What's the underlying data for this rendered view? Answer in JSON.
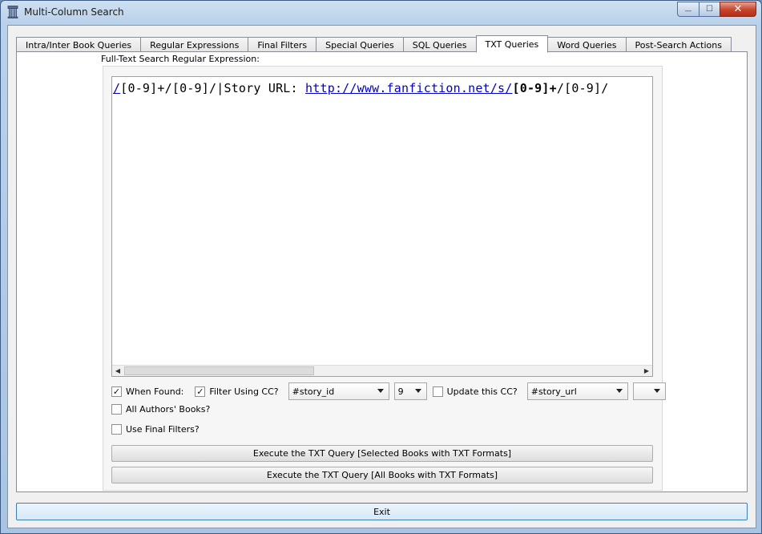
{
  "window": {
    "title": "Multi-Column Search",
    "caption": {
      "minimize": "—",
      "maximize": "☐",
      "close": "✕"
    }
  },
  "tabs": [
    {
      "label": "Intra/Inter Book Queries",
      "active": false
    },
    {
      "label": "Regular Expressions",
      "active": false
    },
    {
      "label": "Final Filters",
      "active": false
    },
    {
      "label": "Special Queries",
      "active": false
    },
    {
      "label": "SQL Queries",
      "active": false
    },
    {
      "label": "TXT Queries",
      "active": true
    },
    {
      "label": "Word Queries",
      "active": false
    },
    {
      "label": "Post-Search Actions",
      "active": false
    }
  ],
  "txt_queries": {
    "section_label": "Full-Text Search Regular Expression:",
    "regex": {
      "p1": "/",
      "p2": "[0-9]+/[0-9]/|Story URL: ",
      "p3": "http://www.fanfiction.net/s/",
      "p4": "[0-9]+",
      "p5": "/[0-9]/"
    },
    "when_found": {
      "label": "When Found:",
      "checked": true,
      "mark": "✓"
    },
    "filter_using_cc": {
      "label": "Filter Using CC?",
      "checked": true,
      "mark": "✓"
    },
    "filter_column": "#story_id",
    "filter_value": "9",
    "update_cc": {
      "label": "Update this CC?",
      "checked": false,
      "mark": ""
    },
    "update_column": "#story_url",
    "update_value": "",
    "all_authors": {
      "label": "All Authors' Books?",
      "checked": false,
      "mark": ""
    },
    "use_final_filters": {
      "label": "Use Final Filters?",
      "checked": false,
      "mark": ""
    },
    "execute_selected": "Execute the TXT Query [Selected Books with TXT Formats]",
    "execute_all": "Execute the TXT Query [All Books with TXT Formats]",
    "scroll": {
      "left": "◀",
      "right": "▶"
    }
  },
  "footer": {
    "exit": "Exit"
  }
}
